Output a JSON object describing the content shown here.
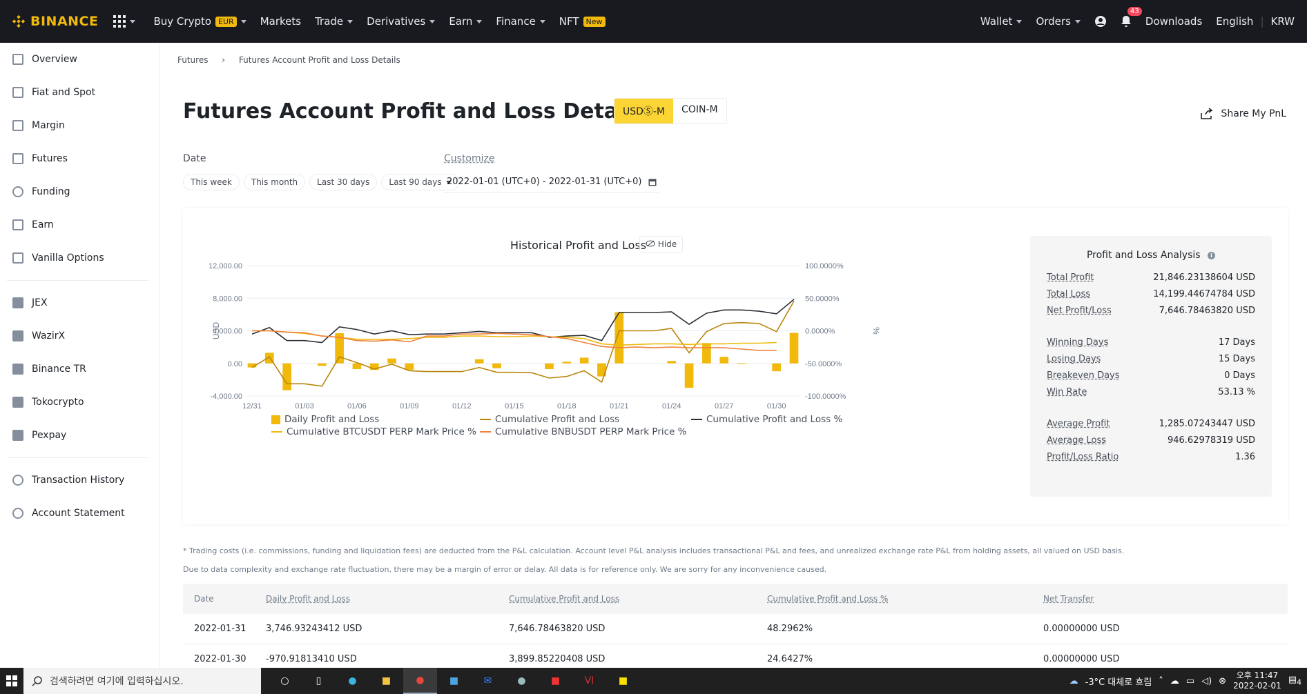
{
  "topbar": {
    "logo": "BINANCE",
    "nav": [
      {
        "label": "Buy Crypto",
        "badge": "EUR"
      },
      {
        "label": "Markets"
      },
      {
        "label": "Trade"
      },
      {
        "label": "Derivatives"
      },
      {
        "label": "Earn"
      },
      {
        "label": "Finance"
      },
      {
        "label": "NFT",
        "badge": "New"
      }
    ],
    "wallet": "Wallet",
    "orders": "Orders",
    "notif_count": "43",
    "downloads": "Downloads",
    "language": "English",
    "currency": "KRW"
  },
  "sidebar": {
    "items": [
      "Overview",
      "Fiat and Spot",
      "Margin",
      "Futures",
      "Funding",
      "Earn",
      "Vanilla Options"
    ],
    "items2": [
      "JEX",
      "WazirX",
      "Binance TR",
      "Tokocrypto",
      "Pexpay"
    ],
    "items3": [
      "Transaction History",
      "Account Statement"
    ]
  },
  "breadcrumb": {
    "root": "Futures",
    "current": "Futures Account Profit and Loss Details"
  },
  "page": {
    "title": "Futures Account Profit and Loss Details",
    "seg_on": "USDⓈ-M",
    "seg_off": "COIN-M",
    "share": "Share My PnL",
    "date_label": "Date",
    "customize": "Customize",
    "pills": [
      "This week",
      "This month",
      "Last 30 days",
      "Last 90 days"
    ],
    "range": "2022-01-01 (UTC+0) - 2022-01-31 (UTC+0)"
  },
  "chart_data": {
    "type": "bar",
    "title": "Historical Profit and Loss",
    "hide": "Hide",
    "ylabel": "USD",
    "y2label": "%",
    "ylim": [
      -4000,
      12000
    ],
    "y2lim": [
      -100,
      100
    ],
    "yticks": [
      "12,000.00",
      "8,000.00",
      "4,000.00",
      "0.00",
      "-4,000.00"
    ],
    "y2ticks": [
      "100.0000%",
      "50.0000%",
      "0.0000%",
      "-50.0000%",
      "-100.0000%"
    ],
    "xticks": [
      "12/31",
      "01/03",
      "01/06",
      "01/09",
      "01/12",
      "01/15",
      "01/18",
      "01/21",
      "01/24",
      "01/27",
      "01/30"
    ],
    "x": [
      "12/31",
      "01/01",
      "01/02",
      "01/03",
      "01/04",
      "01/05",
      "01/06",
      "01/07",
      "01/08",
      "01/09",
      "01/10",
      "01/11",
      "01/12",
      "01/13",
      "01/14",
      "01/15",
      "01/16",
      "01/17",
      "01/18",
      "01/19",
      "01/20",
      "01/21",
      "01/22",
      "01/23",
      "01/24",
      "01/25",
      "01/26",
      "01/27",
      "01/28",
      "01/29",
      "01/30",
      "01/31"
    ],
    "series": [
      {
        "name": "Daily Profit and Loss",
        "kind": "bar",
        "axis": "left",
        "color": "#f0b90b",
        "values": [
          -500,
          1300,
          -3300,
          null,
          -300,
          3700,
          -700,
          -800,
          600,
          -800,
          null,
          null,
          null,
          500,
          -600,
          null,
          null,
          -700,
          200,
          700,
          -1600,
          6300,
          null,
          null,
          300,
          -3000,
          2500,
          800,
          0,
          null,
          -970,
          3747
        ]
      },
      {
        "name": "Cumulative Profit and Loss",
        "kind": "line",
        "axis": "left",
        "color": "#b8860b",
        "values": [
          -500,
          800,
          -2500,
          -2500,
          -2800,
          800,
          100,
          -700,
          -100,
          -900,
          -1000,
          -1000,
          -1000,
          -500,
          -1100,
          -1100,
          -1150,
          -1800,
          -1600,
          -900,
          -2300,
          4000,
          4000,
          4000,
          4300,
          1300,
          3900,
          4900,
          5000,
          4900,
          3900,
          7647
        ]
      },
      {
        "name": "Cumulative Profit and Loss %",
        "kind": "line",
        "axis": "right",
        "color": "#2b2f36",
        "values": [
          -5,
          5,
          -15,
          -15,
          -18,
          6,
          2,
          -5,
          0,
          -6,
          -5,
          -5,
          -3,
          -1,
          -3,
          -3,
          -3,
          -10,
          -8,
          -7,
          -15,
          28,
          28,
          28,
          29,
          10,
          27,
          32,
          32,
          30,
          26,
          48.3
        ]
      },
      {
        "name": "Cumulative BTCUSDT PERP Mark Price %",
        "kind": "line",
        "axis": "right",
        "color": "#f0b90b",
        "values": [
          0,
          0,
          -2,
          -4,
          -8,
          -10,
          -13,
          -13,
          -13,
          -12,
          -10,
          -10,
          -8,
          -8,
          -9,
          -9,
          -8,
          -9,
          -10,
          -12,
          -20,
          -22,
          -21,
          -20,
          -20,
          -21,
          -20,
          -20,
          -19,
          -19,
          -18,
          null
        ]
      },
      {
        "name": "Cumulative BNBUSDT PERP Mark Price %",
        "kind": "line",
        "axis": "right",
        "color": "#f0803c",
        "values": [
          0,
          0,
          -2,
          -3,
          -8,
          -10,
          -15,
          -16,
          -14,
          -17,
          -8,
          -8,
          -5,
          -5,
          -4,
          -5,
          -6,
          -9,
          -12,
          -18,
          -24,
          -26,
          -25,
          -26,
          -25,
          -26,
          -26,
          -26,
          -28,
          -30,
          -30,
          null
        ]
      }
    ]
  },
  "analysis": {
    "title": "Profit and Loss Analysis",
    "groups": [
      [
        [
          "Total Profit",
          "21,846.23138604 USD"
        ],
        [
          "Total Loss",
          "14,199.44674784 USD"
        ],
        [
          "Net Profit/Loss",
          "7,646.78463820 USD"
        ]
      ],
      [
        [
          "Winning Days",
          "17 Days"
        ],
        [
          "Losing Days",
          "15 Days"
        ],
        [
          "Breakeven Days",
          "0 Days"
        ],
        [
          "Win Rate",
          "53.13 %"
        ]
      ],
      [
        [
          "Average Profit",
          "1,285.07243447 USD"
        ],
        [
          "Average Loss",
          "946.62978319 USD"
        ],
        [
          "Profit/Loss Ratio",
          "1.36"
        ]
      ]
    ]
  },
  "notes": [
    "* Trading costs (i.e. commissions, funding and liquidation fees) are deducted from the P&L calculation. Account level P&L analysis includes transactional P&L and fees, and unrealized exchange rate P&L from holding assets, all valued on USD basis.",
    "Due to data complexity and exchange rate fluctuation, there may be a margin of error or delay. All data is for reference only. We are sorry for any inconvenience caused."
  ],
  "table": {
    "headers": [
      "Date",
      "Daily Profit and Loss",
      "Cumulative Profit and Loss",
      "Cumulative Profit and Loss %",
      "Net Transfer"
    ],
    "rows": [
      [
        "2022-01-31",
        "3,746.93243412 USD",
        "7,646.78463820 USD",
        "48.2962%",
        "0.00000000 USD"
      ],
      [
        "2022-01-30",
        "-970.91813410 USD",
        "3,899.85220408 USD",
        "24.6427%",
        "0.00000000 USD"
      ]
    ]
  },
  "taskbar": {
    "search_placeholder": "검색하려면 여기에 입력하십시오.",
    "weather": "-3°C 대체로 흐림",
    "time": "오후 11:47",
    "date": "2022-02-01",
    "notif": "4"
  }
}
